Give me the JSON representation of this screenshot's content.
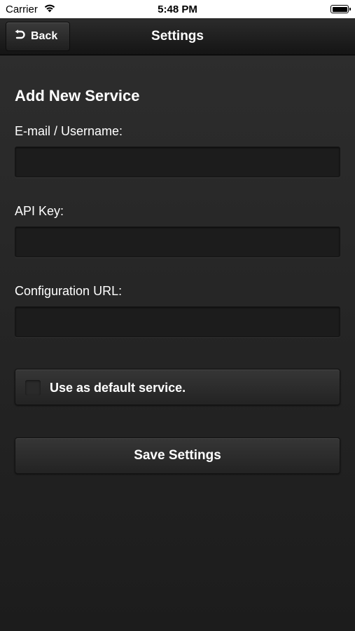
{
  "status_bar": {
    "carrier": "Carrier",
    "time": "5:48 PM",
    "wifi_icon": "wifi-icon",
    "battery_icon": "battery-icon"
  },
  "nav_bar": {
    "back_label": "Back",
    "back_icon": "undo-arrow-icon",
    "title": "Settings"
  },
  "form": {
    "section_title": "Add New Service",
    "email_label": "E-mail / Username:",
    "email_value": "",
    "api_key_label": "API Key:",
    "api_key_value": "",
    "config_url_label": "Configuration URL:",
    "config_url_value": "",
    "default_service_label": "Use as default service.",
    "default_service_checked": false,
    "save_label": "Save Settings"
  },
  "colors": {
    "background": "#2a2a2a",
    "input_background": "#1c1c1c",
    "text": "#ffffff"
  }
}
